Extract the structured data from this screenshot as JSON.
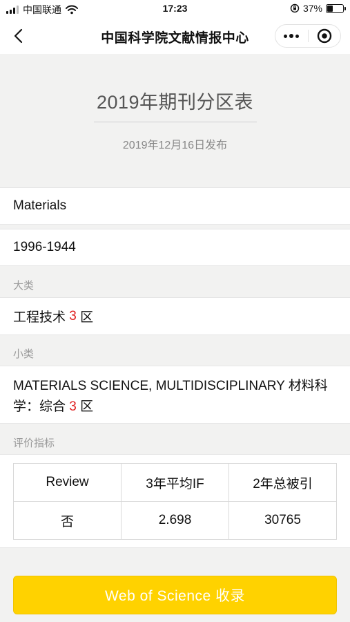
{
  "status_bar": {
    "carrier": "中国联通",
    "time": "17:23",
    "battery": "37%",
    "battery_level": 0.37
  },
  "nav": {
    "title": "中国科学院文献情报中心"
  },
  "header": {
    "title": "2019年期刊分区表",
    "publish_date": "2019年12月16日发布"
  },
  "journal": {
    "name": "Materials",
    "issn": "1996-1944"
  },
  "major_category": {
    "label": "大类",
    "text": "工程技术",
    "zone": "3",
    "zone_suffix": "区"
  },
  "minor_category": {
    "label": "小类",
    "text": "MATERIALS SCIENCE, MULTIDISCIPLINARY 材料科学：综合",
    "zone": "3",
    "zone_suffix": "区"
  },
  "metrics": {
    "label": "评价指标",
    "headers": [
      "Review",
      "3年平均IF",
      "2年总被引"
    ],
    "values": [
      "否",
      "2.698",
      "30765"
    ]
  },
  "button": {
    "label": "Web of Science 收录"
  },
  "colors": {
    "accent": "#ffd200",
    "zone_red": "#e02020"
  }
}
